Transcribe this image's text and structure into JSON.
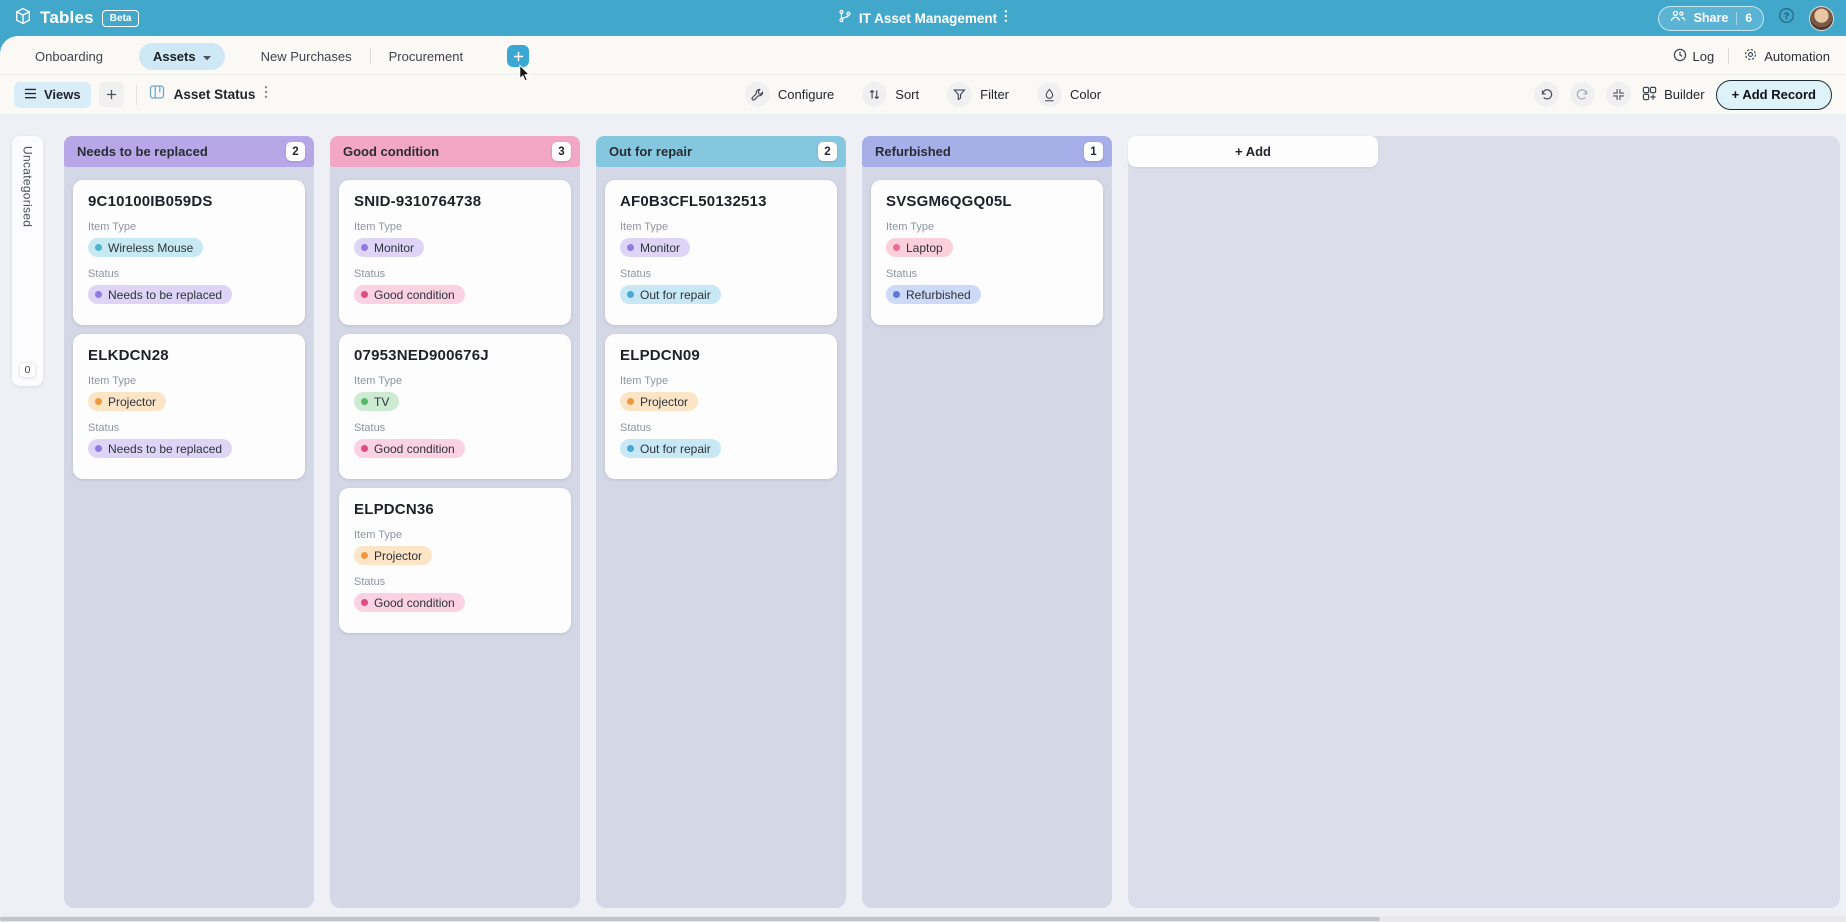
{
  "brand": {
    "topbar_bg": "#41a8cc",
    "accent": "#3aa8d2"
  },
  "topbar": {
    "app_name": "Tables",
    "beta_label": "Beta",
    "workspace_title": "IT Asset Management",
    "share_label": "Share",
    "share_count": "6"
  },
  "tabs": {
    "items": [
      {
        "label": "Onboarding"
      },
      {
        "label": "Assets"
      },
      {
        "label": "New Purchases"
      },
      {
        "label": "Procurement"
      }
    ],
    "active_tab": "Assets",
    "log_label": "Log",
    "automation_label": "Automation"
  },
  "toolbar": {
    "views_label": "Views",
    "view_name": "Asset Status",
    "configure_label": "Configure",
    "sort_label": "Sort",
    "filter_label": "Filter",
    "color_label": "Color",
    "builder_label": "Builder",
    "add_record_label": "+ Add Record"
  },
  "board": {
    "uncategorised": {
      "label": "Uncategorised",
      "count": "0"
    },
    "add_column_label": "+ Add",
    "field_labels": {
      "item_type": "Item Type",
      "status": "Status"
    },
    "columns": [
      {
        "title": "Needs to be replaced",
        "count": "2",
        "header_bg": "#b7a7e6",
        "cards": [
          {
            "title": "9C10100IB059DS",
            "item_type": {
              "label": "Wireless Mouse",
              "bg": "#c7e9f3",
              "dot": "#4fb3cf"
            },
            "status": {
              "label": "Needs to be replaced",
              "bg": "#ded5f6",
              "dot": "#8f7ce0"
            }
          },
          {
            "title": "ELKDCN28",
            "item_type": {
              "label": "Projector",
              "bg": "#fce4c7",
              "dot": "#f0993c"
            },
            "status": {
              "label": "Needs to be replaced",
              "bg": "#ded5f6",
              "dot": "#8f7ce0"
            }
          }
        ]
      },
      {
        "title": "Good condition",
        "count": "3",
        "header_bg": "#f2a7c5",
        "cards": [
          {
            "title": "SNID-9310764738",
            "item_type": {
              "label": "Monitor",
              "bg": "#ded5f6",
              "dot": "#8f7ce0"
            },
            "status": {
              "label": "Good condition",
              "bg": "#fad2e2",
              "dot": "#dd4e80"
            }
          },
          {
            "title": "07953NED900676J",
            "item_type": {
              "label": "TV",
              "bg": "#cdebd2",
              "dot": "#54ba66"
            },
            "status": {
              "label": "Good condition",
              "bg": "#fad2e2",
              "dot": "#dd4e80"
            }
          },
          {
            "title": "ELPDCN36",
            "item_type": {
              "label": "Projector",
              "bg": "#fce4c7",
              "dot": "#f0993c"
            },
            "status": {
              "label": "Good condition",
              "bg": "#fad2e2",
              "dot": "#dd4e80"
            }
          }
        ]
      },
      {
        "title": "Out for repair",
        "count": "2",
        "header_bg": "#86c7e0",
        "cards": [
          {
            "title": "AF0B3CFL50132513",
            "item_type": {
              "label": "Monitor",
              "bg": "#ded5f6",
              "dot": "#8f7ce0"
            },
            "status": {
              "label": "Out for repair",
              "bg": "#c7e8f4",
              "dot": "#49a9d6"
            }
          },
          {
            "title": "ELPDCN09",
            "item_type": {
              "label": "Projector",
              "bg": "#fce4c7",
              "dot": "#f0993c"
            },
            "status": {
              "label": "Out for repair",
              "bg": "#c7e8f4",
              "dot": "#49a9d6"
            }
          }
        ]
      },
      {
        "title": "Refurbished",
        "count": "1",
        "header_bg": "#a7afe9",
        "cards": [
          {
            "title": "SVSGM6QGQ05L",
            "item_type": {
              "label": "Laptop",
              "bg": "#fbd0dc",
              "dot": "#ec6a94"
            },
            "status": {
              "label": "Refurbished",
              "bg": "#ccd9f7",
              "dot": "#5d77dc"
            }
          }
        ]
      }
    ]
  }
}
